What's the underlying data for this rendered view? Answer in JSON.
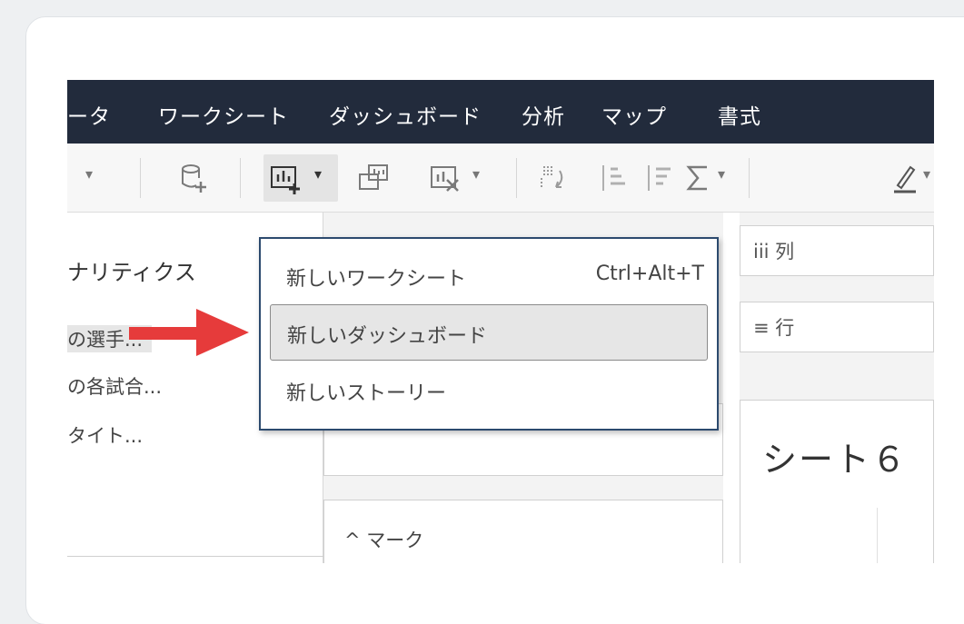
{
  "menubar": {
    "items": [
      "ータ",
      "ワークシート",
      "ダッシュボード",
      "分析",
      "マップ",
      "書式"
    ]
  },
  "toolbar": {
    "icons": [
      "dropdown-caret",
      "new-datasource-icon",
      "new-worksheet-icon",
      "duplicate-icon",
      "clear-icon",
      "swap-icon",
      "sort-ascending-icon",
      "sort-descending-icon",
      "sum-icon",
      "highlight-icon"
    ]
  },
  "left_panel": {
    "heading": "ナリティクス",
    "items": [
      "の選手...",
      "の各試合...",
      "タイト..."
    ]
  },
  "dropdown": {
    "items": [
      {
        "label": "新しいワークシート",
        "shortcut": "Ctrl+Alt+T"
      },
      {
        "label": "新しいダッシュボード",
        "shortcut": ""
      },
      {
        "label": "新しいストーリー",
        "shortcut": ""
      }
    ]
  },
  "marks": {
    "title": "^ マーク"
  },
  "shelves": {
    "columns": "iii 列",
    "rows": "≡ 行"
  },
  "sheet": {
    "title": "シート６"
  },
  "colors": {
    "menubar_bg": "#222b3c",
    "dropdown_border": "#2c4a6e",
    "arrow": "#e63b3b"
  }
}
